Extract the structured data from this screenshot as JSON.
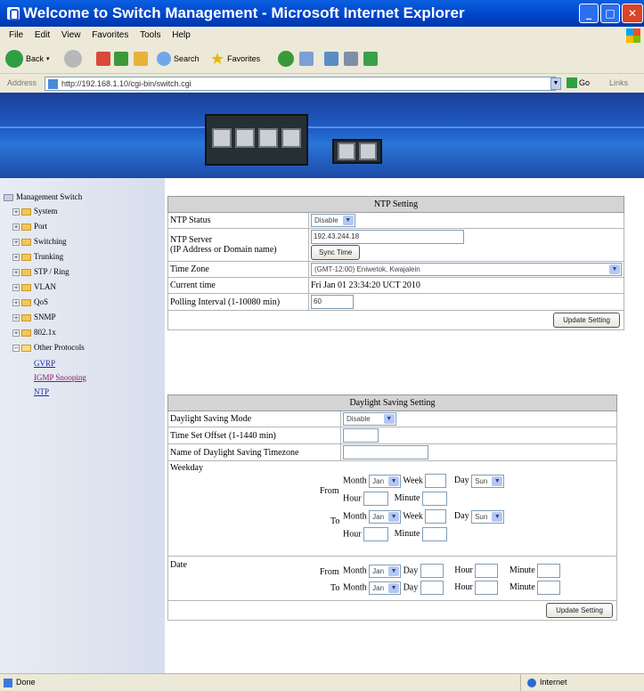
{
  "window": {
    "title": "Welcome to Switch Management - Microsoft Internet Explorer"
  },
  "menu": [
    "File",
    "Edit",
    "View",
    "Favorites",
    "Tools",
    "Help"
  ],
  "toolbar": {
    "back": "Back",
    "search": "Search",
    "favorites": "Favorites"
  },
  "address": {
    "label": "Address",
    "url": "http://192.168.1.10/cgi-bin/switch.cgi",
    "go": "Go",
    "links": "Links"
  },
  "tree": {
    "root": "Management Switch",
    "items": [
      "System",
      "Port",
      "Switching",
      "Trunking",
      "STP / Ring",
      "VLAN",
      "QoS",
      "SNMP",
      "802.1x",
      "Other Protocols"
    ],
    "leaves": [
      "GVRP",
      "IGMP Snooping",
      "NTP"
    ]
  },
  "ntp": {
    "header": "NTP Setting",
    "status_label": "NTP Status",
    "status_value": "Disable",
    "server_label_1": "NTP Server",
    "server_label_2": "(IP Address or Domain name)",
    "server_value": "192.43.244.18",
    "sync_button": "Sync Time",
    "timezone_label": "Time Zone",
    "timezone_value": "(GMT-12:00) Eniwetok, Kwajalein",
    "current_label": "Current time",
    "current_value": "Fri Jan 01 23:34:20 UCT 2010",
    "polling_label": "Polling Interval (1-10080 min)",
    "polling_value": "60",
    "update_button": "Update Setting"
  },
  "dst": {
    "header": "Daylight Saving Setting",
    "mode_label": "Daylight Saving Mode",
    "mode_value": "Disable",
    "offset_label": "Time Set Offset (1-1440 min)",
    "name_label": "Name of Daylight Saving Timezone",
    "weekday_label": "Weekday",
    "date_label": "Date",
    "from": "From",
    "to": "To",
    "month": "Month",
    "week": "Week",
    "day": "Day",
    "hour": "Hour",
    "minute": "Minute",
    "month_value": "Jan",
    "day_value": "Sun",
    "update_button": "Update Setting"
  },
  "status": {
    "left": "Done",
    "zone": "Internet"
  }
}
